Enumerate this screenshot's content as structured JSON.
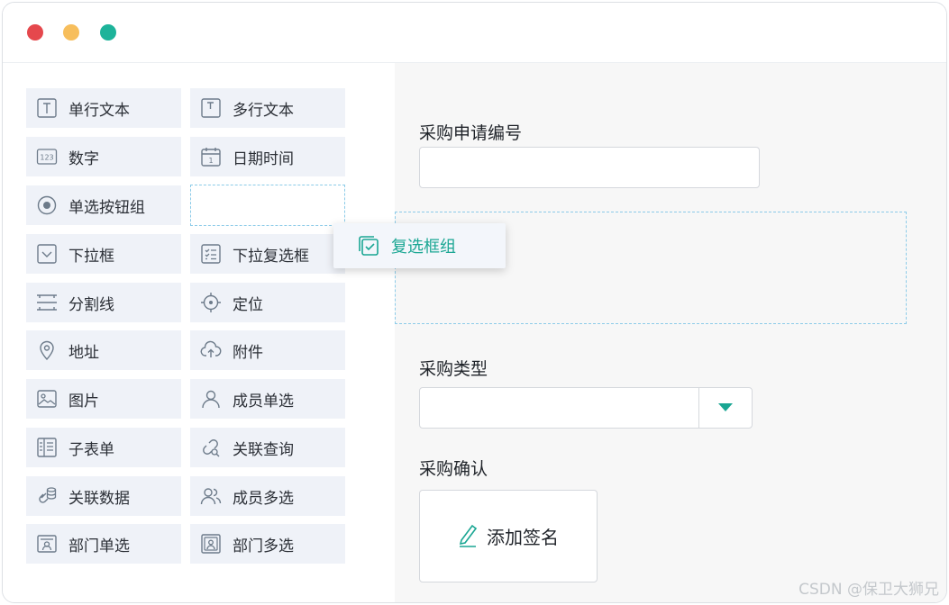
{
  "window": {
    "controls": [
      "close",
      "minimize",
      "maximize"
    ]
  },
  "palette": [
    {
      "label": "单行文本",
      "icon": "single-line-text-icon"
    },
    {
      "label": "多行文本",
      "icon": "multi-line-text-icon"
    },
    {
      "label": "数字",
      "icon": "number-icon"
    },
    {
      "label": "日期时间",
      "icon": "calendar-icon"
    },
    {
      "label": "单选按钮组",
      "icon": "radio-icon"
    },
    {
      "label": "",
      "icon": ""
    },
    {
      "label": "下拉框",
      "icon": "dropdown-icon"
    },
    {
      "label": "下拉复选框",
      "icon": "checklist-icon"
    },
    {
      "label": "分割线",
      "icon": "divider-icon"
    },
    {
      "label": "定位",
      "icon": "locate-icon"
    },
    {
      "label": "地址",
      "icon": "map-pin-icon"
    },
    {
      "label": "附件",
      "icon": "cloud-upload-icon"
    },
    {
      "label": "图片",
      "icon": "image-icon"
    },
    {
      "label": "成员单选",
      "icon": "user-icon"
    },
    {
      "label": "子表单",
      "icon": "subform-icon"
    },
    {
      "label": "关联查询",
      "icon": "link-query-icon"
    },
    {
      "label": "关联数据",
      "icon": "link-data-icon"
    },
    {
      "label": "成员多选",
      "icon": "users-icon"
    },
    {
      "label": "部门单选",
      "icon": "department-icon"
    },
    {
      "label": "部门多选",
      "icon": "departments-icon"
    }
  ],
  "drag_item": {
    "label": "复选框组",
    "icon": "checkbox-group-icon"
  },
  "form": {
    "field1_label": "采购申请编号",
    "field1_value": "",
    "field2_label": "采购类型",
    "field2_value": "",
    "field3_label": "采购确认",
    "sign_label": "添加签名"
  },
  "watermark": "CSDN @保卫大狮兄",
  "colors": {
    "accent": "#1aa693",
    "tile": "#eff2f8",
    "dash": "#8ccbe8"
  }
}
